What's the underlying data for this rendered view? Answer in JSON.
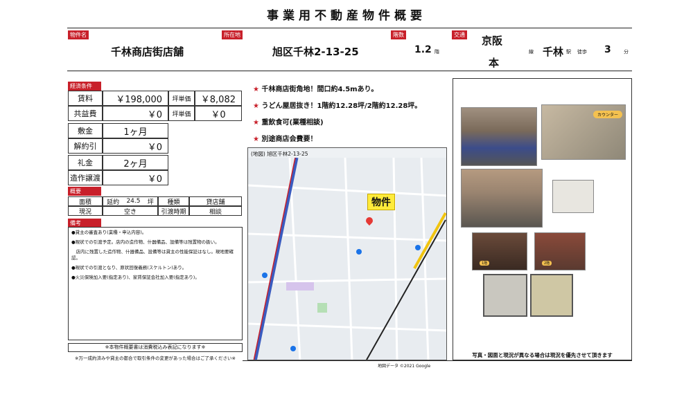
{
  "title": "事業用不動産物件概要",
  "header": {
    "name_label": "物件名",
    "name_value": "千林商店街店舗",
    "address_label": "所在地",
    "address_value": "旭区千林2-13-25",
    "floor_label": "階数",
    "floor_value": "1.2",
    "floor_unit": "階",
    "access_label": "交通",
    "line_value_1": "京阪",
    "line_value_2": "本",
    "line_unit": "線",
    "station_value": "千林",
    "station_unit": "駅",
    "walk_label": "徒歩",
    "walk_value": "3",
    "walk_unit": "分"
  },
  "economy": {
    "section_label": "経済条件",
    "rent_label": "賃料",
    "rent_value": "￥198,000",
    "tsubo_label": "坪単価",
    "tsubo_value": "￥8,082",
    "common_label": "共益費",
    "common_value": "￥0",
    "tsubo2_label": "坪単価",
    "tsubo2_value": "￥0",
    "deposit_label": "敷金",
    "deposit_value": "1ヶ月",
    "cancel_label": "解約引",
    "cancel_value": "￥0",
    "key_label": "礼金",
    "key_value": "2ヶ月",
    "transfer_label": "造作譲渡",
    "transfer_value": "￥0"
  },
  "overview": {
    "section_label": "概要",
    "area_label": "面積",
    "area_prefix": "延約",
    "area_value": "24.5",
    "area_unit": "坪",
    "type_label": "種類",
    "type_value": "貸店舗",
    "status_label": "現況",
    "status_value": "空き",
    "handover_label": "引渡時期",
    "handover_value": "相談"
  },
  "remarks": {
    "section_label": "備考",
    "lines": [
      "●貸主の審査あり(業種・申込内容)。",
      "●現状での引渡予定。店内の造作物、什器備品、設備等は残置物の扱い。",
      "　店内に残置した造作物、什器備品、設備等は貸主の性能保証はなし。現地要確認。",
      "●現状での引渡となり、原状回復義務(スケルトン)あり。",
      "●火災保険加入要(指定あり)、家賃保証会社加入要(指定あり)。"
    ],
    "tax_note": "※本物件概要書は消費税込み表記になります※",
    "change_note": "※万一成約済みや貸主の都合で取引条件の変更があった場合はご了承ください※"
  },
  "features": [
    "千林商店街角地！間口約4.5mあり。",
    "うどん屋居抜き！1階約12.28坪/2階約12.28坪。",
    "重飲食可(業種相談)",
    "別途商店会費要！"
  ],
  "map": {
    "caption": "(地図) 旭区千林2-13-25",
    "marker_label": "物件",
    "credit": "地図データ ©2021 Google"
  },
  "photos": {
    "counter_label": "カウンター",
    "floor1_label": "1階",
    "floor2_label": "2階",
    "footer_note": "写真・図面と現況が異なる場合は現況を優先させて頂きます"
  },
  "colors": {
    "accent": "#c8202a",
    "rule": "#222222"
  }
}
